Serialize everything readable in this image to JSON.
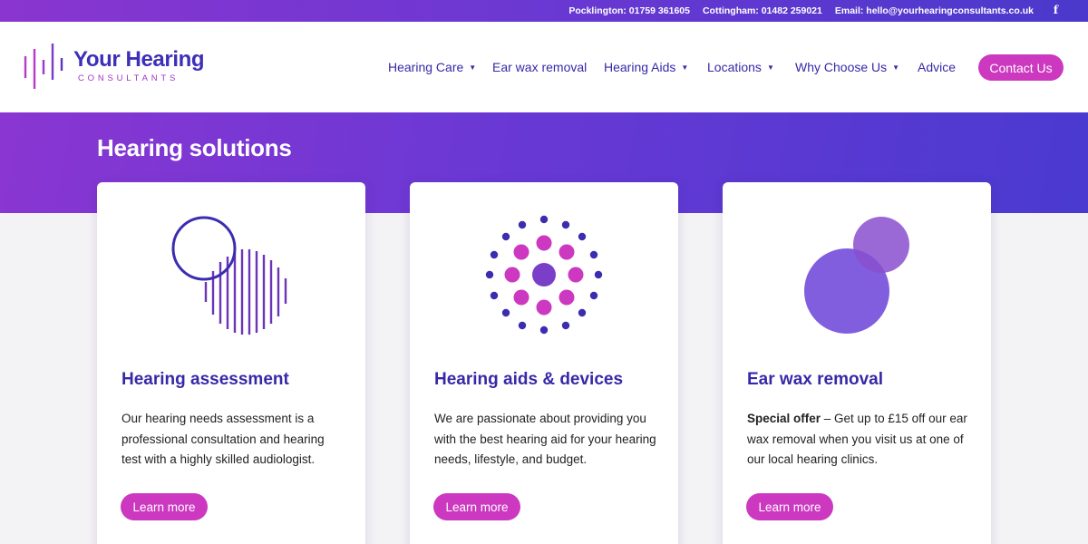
{
  "topbar": {
    "pocklington": "Pocklington: 01759 361605",
    "cottingham": "Cottingham: 01482 259021",
    "email": "Email: hello@yourhearingconsultants.co.uk",
    "facebook_glyph": "f"
  },
  "logo": {
    "title": "Your Hearing",
    "subtitle": "CONSULTANTS"
  },
  "nav": {
    "items": [
      {
        "label": "Hearing Care",
        "has_dropdown": true
      },
      {
        "label": "Ear wax removal",
        "has_dropdown": false
      },
      {
        "label": "Hearing Aids",
        "has_dropdown": true
      },
      {
        "label": "Locations",
        "has_dropdown": true
      },
      {
        "label": "Why Choose Us",
        "has_dropdown": true
      },
      {
        "label": "Advice",
        "has_dropdown": false
      }
    ],
    "caret": "▼",
    "contact_label": "Contact Us"
  },
  "hero": {
    "title": "Hearing solutions"
  },
  "cards": [
    {
      "icon": "circle-lines-icon",
      "title": "Hearing assessment",
      "text": "Our hearing needs assessment is a professional consultation and hearing test with a highly skilled audiologist.",
      "button": "Learn more"
    },
    {
      "icon": "dot-burst-icon",
      "title": "Hearing aids & devices",
      "text": "We are passionate about providing you with the best hearing aid for your hearing needs, lifestyle, and budget.",
      "button": "Learn more"
    },
    {
      "icon": "overlapping-circles-icon",
      "title": "Ear wax removal",
      "text_bold": "Special offer",
      "text": " – Get up to £15 off our ear wax removal when you visit us at one of our local hearing clinics.",
      "button": "Learn more"
    }
  ],
  "colors": {
    "brand_navy": "#3728a8",
    "brand_magenta": "#cc38bf",
    "brand_purple": "#7a3ec9",
    "gradient_start": "#8a36d2",
    "gradient_end": "#4a3ad0"
  }
}
